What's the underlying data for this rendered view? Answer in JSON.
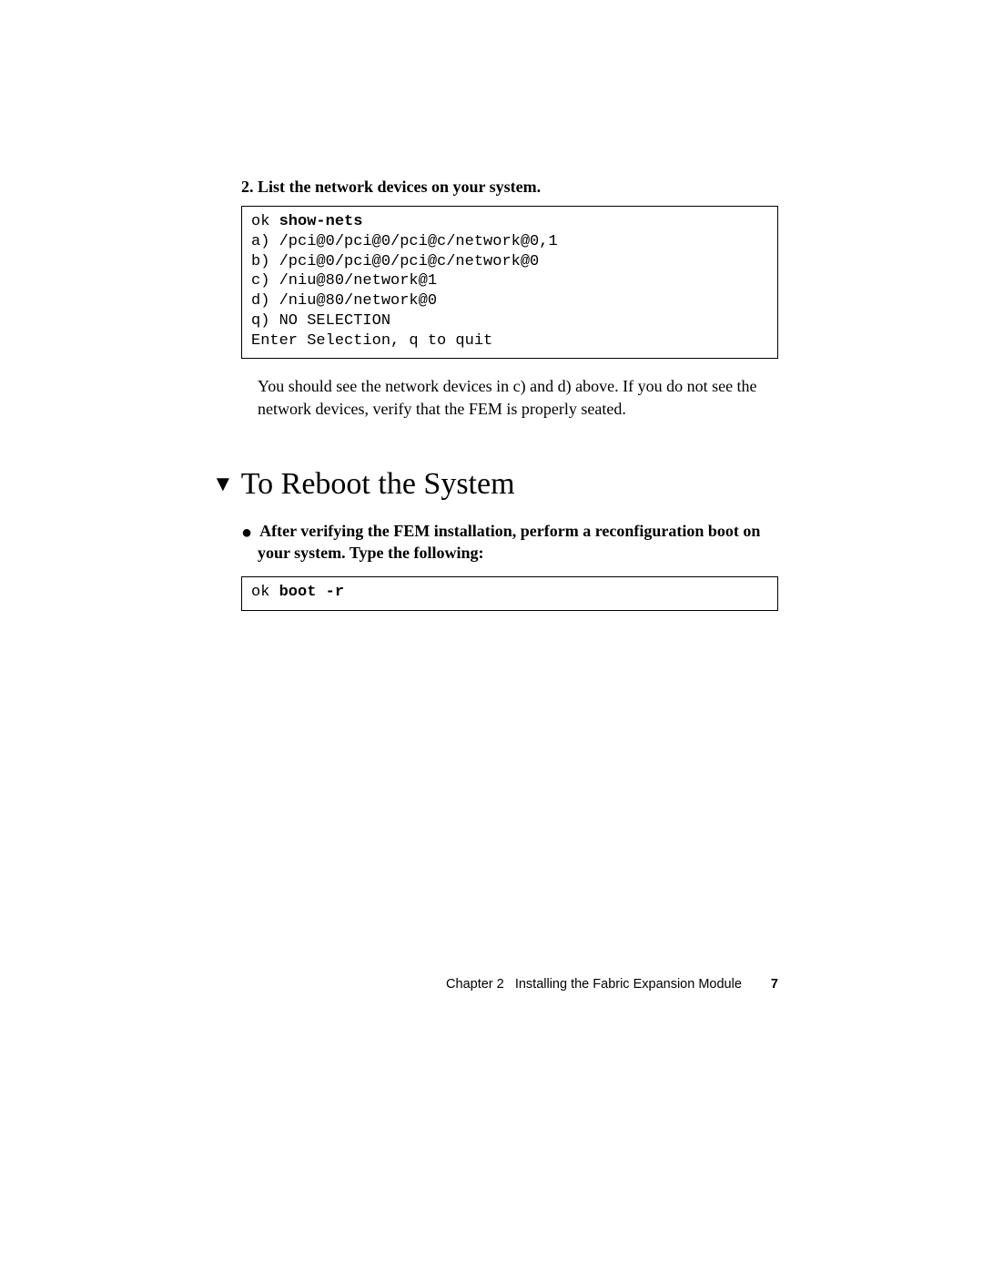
{
  "step2": {
    "number": "2.",
    "text": "List the network devices on your system."
  },
  "code1": {
    "prompt": "ok ",
    "cmd": "show-nets",
    "lines": [
      "a) /pci@0/pci@0/pci@c/network@0,1",
      "b) /pci@0/pci@0/pci@c/network@0",
      "c) /niu@80/network@1",
      "d) /niu@80/network@0",
      "q) NO SELECTION",
      "Enter Selection, q to quit"
    ]
  },
  "para1": "You should see the network devices in c) and d) above. If you do not see the network devices, verify that the FEM is properly seated.",
  "heading": "To Reboot the System",
  "bullet": {
    "text": "After verifying the FEM installation, perform a reconfiguration boot on your system. Type the following:"
  },
  "code2": {
    "prompt": "ok ",
    "cmd": "boot -r"
  },
  "footer": {
    "chapter": "Chapter 2",
    "title": "Installing the Fabric Expansion Module",
    "page": "7"
  }
}
